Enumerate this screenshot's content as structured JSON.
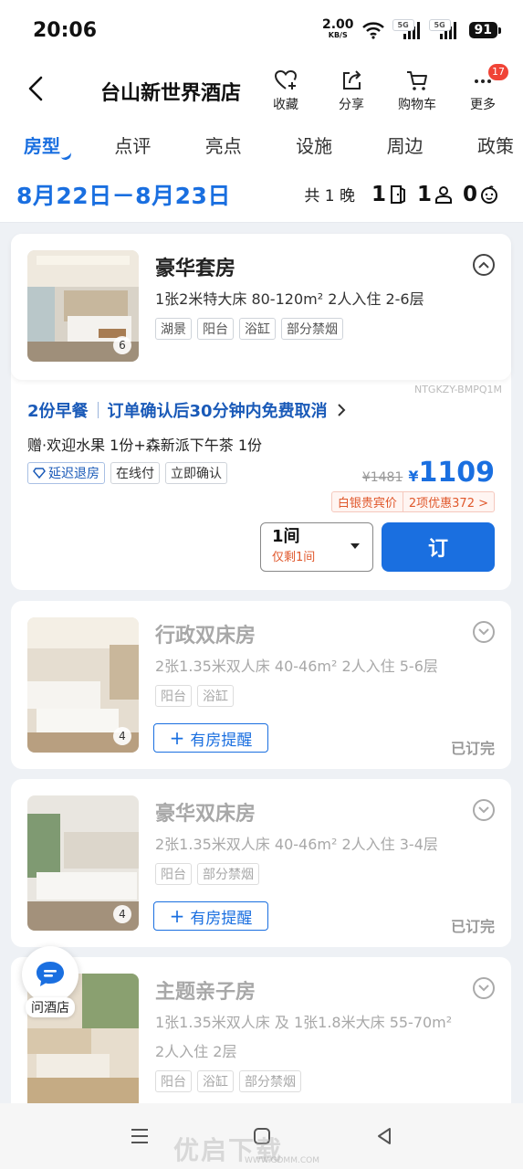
{
  "status_bar": {
    "time": "20:06",
    "net_speed": "2.00",
    "net_unit": "KB/S",
    "sig1": "5G",
    "sig2": "5G",
    "battery": "91"
  },
  "header": {
    "back_icon": "chevron-left-icon",
    "title": "台山新世界酒店",
    "actions": [
      {
        "label": "收藏",
        "icon": "heart-plus-icon"
      },
      {
        "label": "分享",
        "icon": "share-icon"
      },
      {
        "label": "购物车",
        "icon": "cart-icon"
      },
      {
        "label": "更多",
        "icon": "more-icon",
        "badge": "17"
      }
    ]
  },
  "tabs": [
    "房型",
    "点评",
    "亮点",
    "设施",
    "周边",
    "政策"
  ],
  "datebar": {
    "dates": "8月22日－8月23日",
    "nights": "共 1 晚",
    "rooms": "1",
    "adults": "1",
    "children": "0"
  },
  "rooms": [
    {
      "name": "豪华套房",
      "desc": "1张2米特大床  80-120m²  2人入住  2-6层",
      "tags": [
        "湖景",
        "阳台",
        "浴缸",
        "部分禁烟"
      ],
      "photos": "6",
      "code": "NTGKZY-BMPQ1M",
      "plan_breakfast": "2份早餐",
      "plan_cancel": "订单确认后30分钟内免费取消",
      "gift": "赠·欢迎水果 1份+森新派下午茶 1份",
      "plan_tags": [
        "延迟退房",
        "在线付",
        "立即确认"
      ],
      "price_old": "¥1481",
      "price_currency": "¥",
      "price_now": "1109",
      "promo_member": "白银贵宾价",
      "promo_discount": "2项优惠372 >",
      "qty": "1间",
      "qty_note": "仅剩1间",
      "book": "订"
    },
    {
      "name": "行政双床房",
      "desc": "2张1.35米双人床  40-46m²  2人入住  5-6层",
      "tags": [
        "阳台",
        "浴缸"
      ],
      "photos": "4",
      "remind": "有房提醒",
      "status": "已订完"
    },
    {
      "name": "豪华双床房",
      "desc": "2张1.35米双人床  40-46m²  2人入住  3-4层",
      "tags": [
        "阳台",
        "部分禁烟"
      ],
      "photos": "4",
      "remind": "有房提醒",
      "status": "已订完"
    },
    {
      "name": "主题亲子房",
      "desc1": "1张1.35米双人床 及 1张1.8米大床  55-70m²",
      "desc2": "2人入住  2层",
      "tags": [
        "阳台",
        "浴缸",
        "部分禁烟"
      ]
    }
  ],
  "assistant": {
    "label": "问酒店",
    "icon": "chat-bubble-icon"
  },
  "watermark": {
    "main": "优启下载",
    "url": "WWW.GDMM.COM"
  },
  "colors": {
    "accent": "#1a6fe0",
    "promo": "#e0582c"
  }
}
